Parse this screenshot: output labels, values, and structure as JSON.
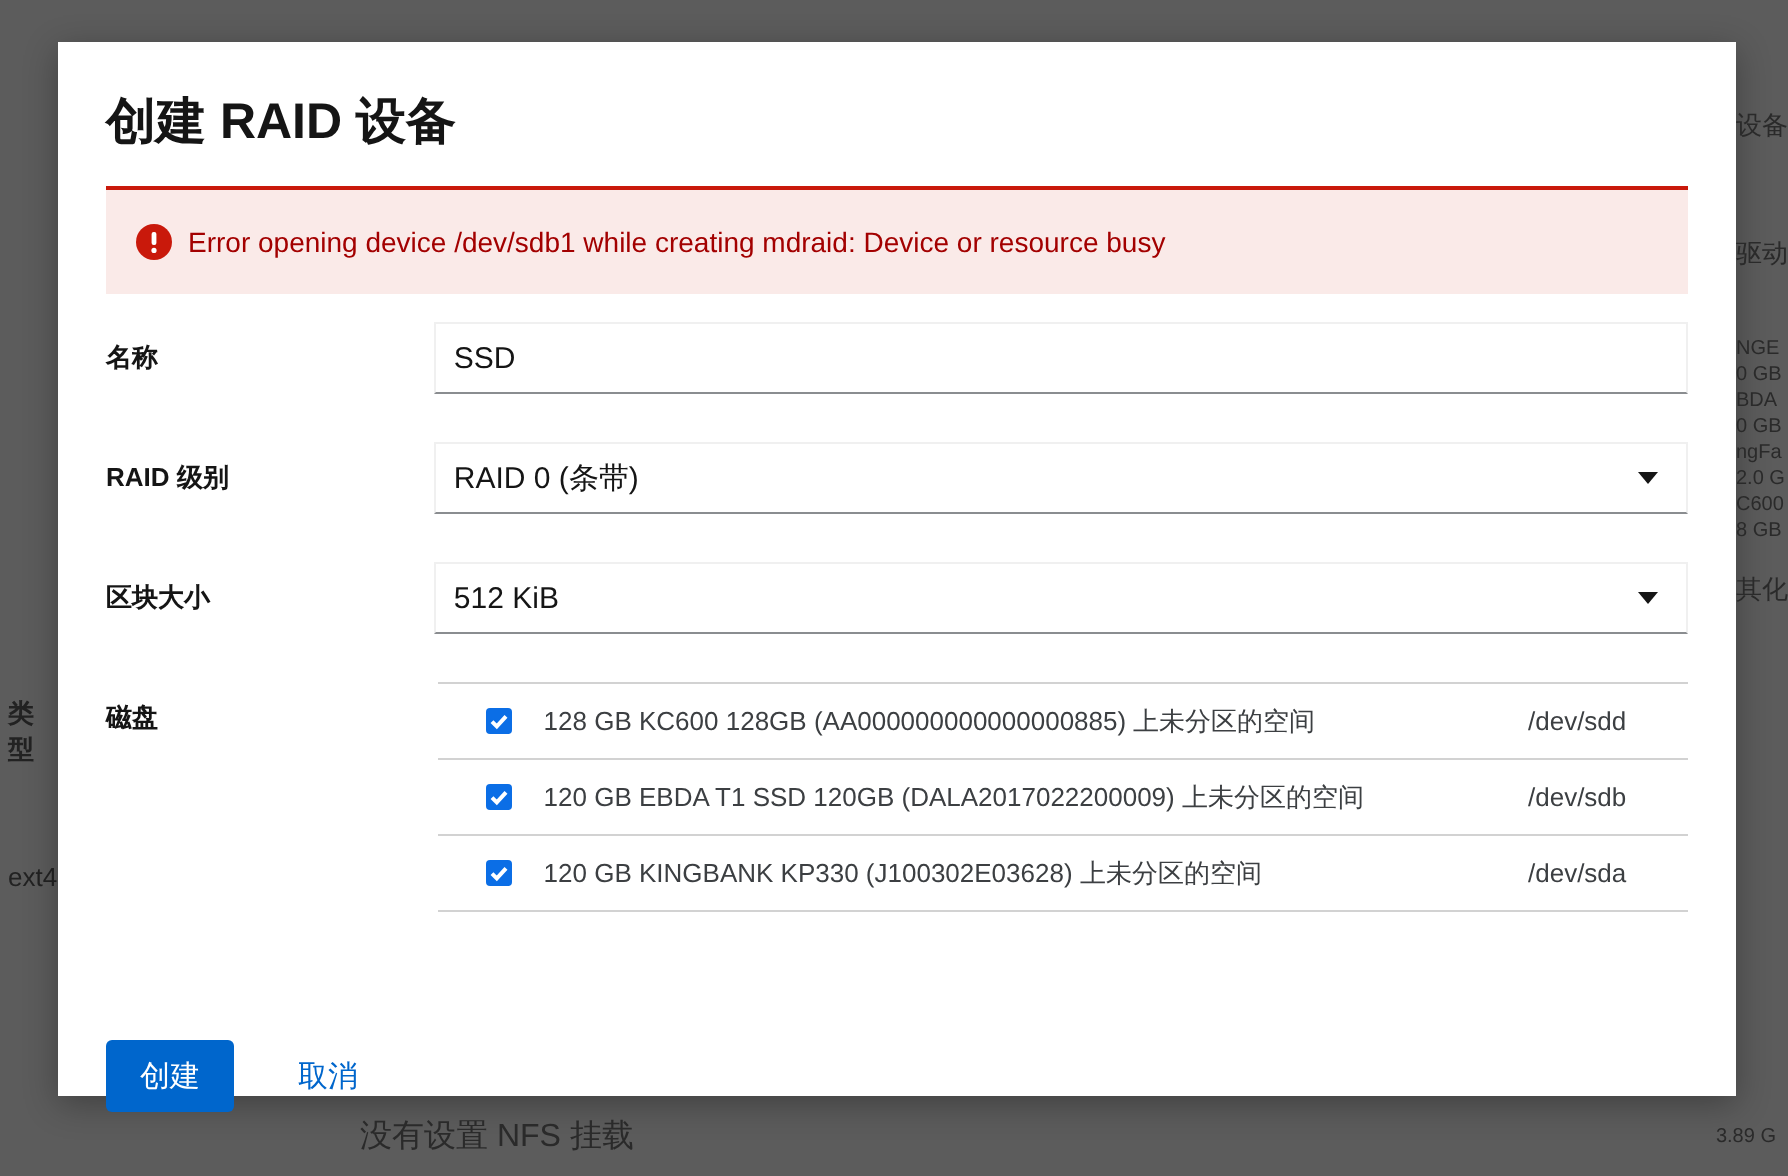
{
  "background": {
    "left": [
      "类型",
      "ext4"
    ],
    "right": [
      "设备",
      "驱动",
      "NGE",
      "0 GB",
      "BDA",
      "0 GB",
      "ngFa",
      "2.0 G",
      "C600",
      "8 GB",
      "其化"
    ],
    "bottom": "没有设置 NFS 挂载",
    "bottom_right": "3.89 G"
  },
  "dialog": {
    "title": "创建 RAID 设备",
    "error": "Error opening device /dev/sdb1 while creating mdraid: Device or resource busy",
    "fields": [
      {
        "kind": "text",
        "label": "名称",
        "value": "SSD"
      },
      {
        "kind": "select",
        "label": "RAID 级别",
        "value": "RAID 0 (条带)"
      },
      {
        "kind": "select",
        "label": "区块大小",
        "value": "512 KiB"
      },
      {
        "kind": "disks",
        "label": "磁盘",
        "disks": [
          {
            "checked": true,
            "description": "128 GB KC600 128GB (AA000000000000000885) 上未分区的空间",
            "device": "/dev/sdd"
          },
          {
            "checked": true,
            "description": "120 GB EBDA T1 SSD 120GB (DALA2017022200009) 上未分区的空间",
            "device": "/dev/sdb"
          },
          {
            "checked": true,
            "description": "120 GB KINGBANK KP330 (J100302E03628) 上未分区的空间",
            "device": "/dev/sda"
          }
        ]
      }
    ],
    "buttons": [
      {
        "kind": "primary",
        "label": "创建"
      },
      {
        "kind": "link",
        "label": "取消"
      }
    ]
  }
}
